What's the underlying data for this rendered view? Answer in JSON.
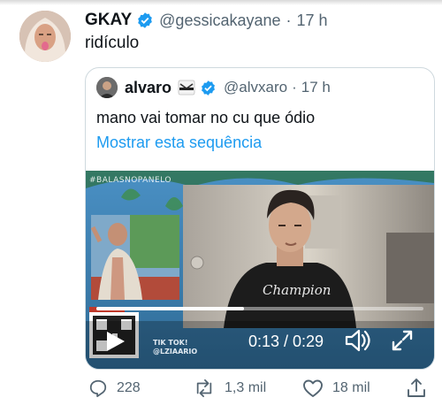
{
  "tweet": {
    "display_name": "GKAY",
    "handle": "@gessicakayane",
    "separator": "·",
    "time": "17 h",
    "text": "ridículo"
  },
  "quoted": {
    "display_name": "alvaro",
    "handle": "@alvxaro",
    "separator": "·",
    "time": "17 h",
    "text": "mano vai tomar no cu que ódio",
    "thread_link": "Mostrar esta sequência",
    "video": {
      "hashtag": "#BALASNOPANELO",
      "tiktok_label": "TIK TOK!",
      "tiktok_user": "@LZIAARIO",
      "shirt_text": "Champion",
      "time_display": "0:13 / 0:29",
      "progress_fraction": 0.45
    }
  },
  "actions": {
    "replies": "228",
    "retweets": "1,3 mil",
    "likes": "18 mil"
  },
  "colors": {
    "verified": "#1d9bf0",
    "link": "#1d9bf0",
    "secondary_text": "#536471"
  },
  "icons": [
    "verified-badge-icon",
    "karate-icon",
    "play-icon",
    "volume-icon",
    "fullscreen-icon",
    "reply-icon",
    "retweet-icon",
    "like-icon",
    "share-icon"
  ]
}
